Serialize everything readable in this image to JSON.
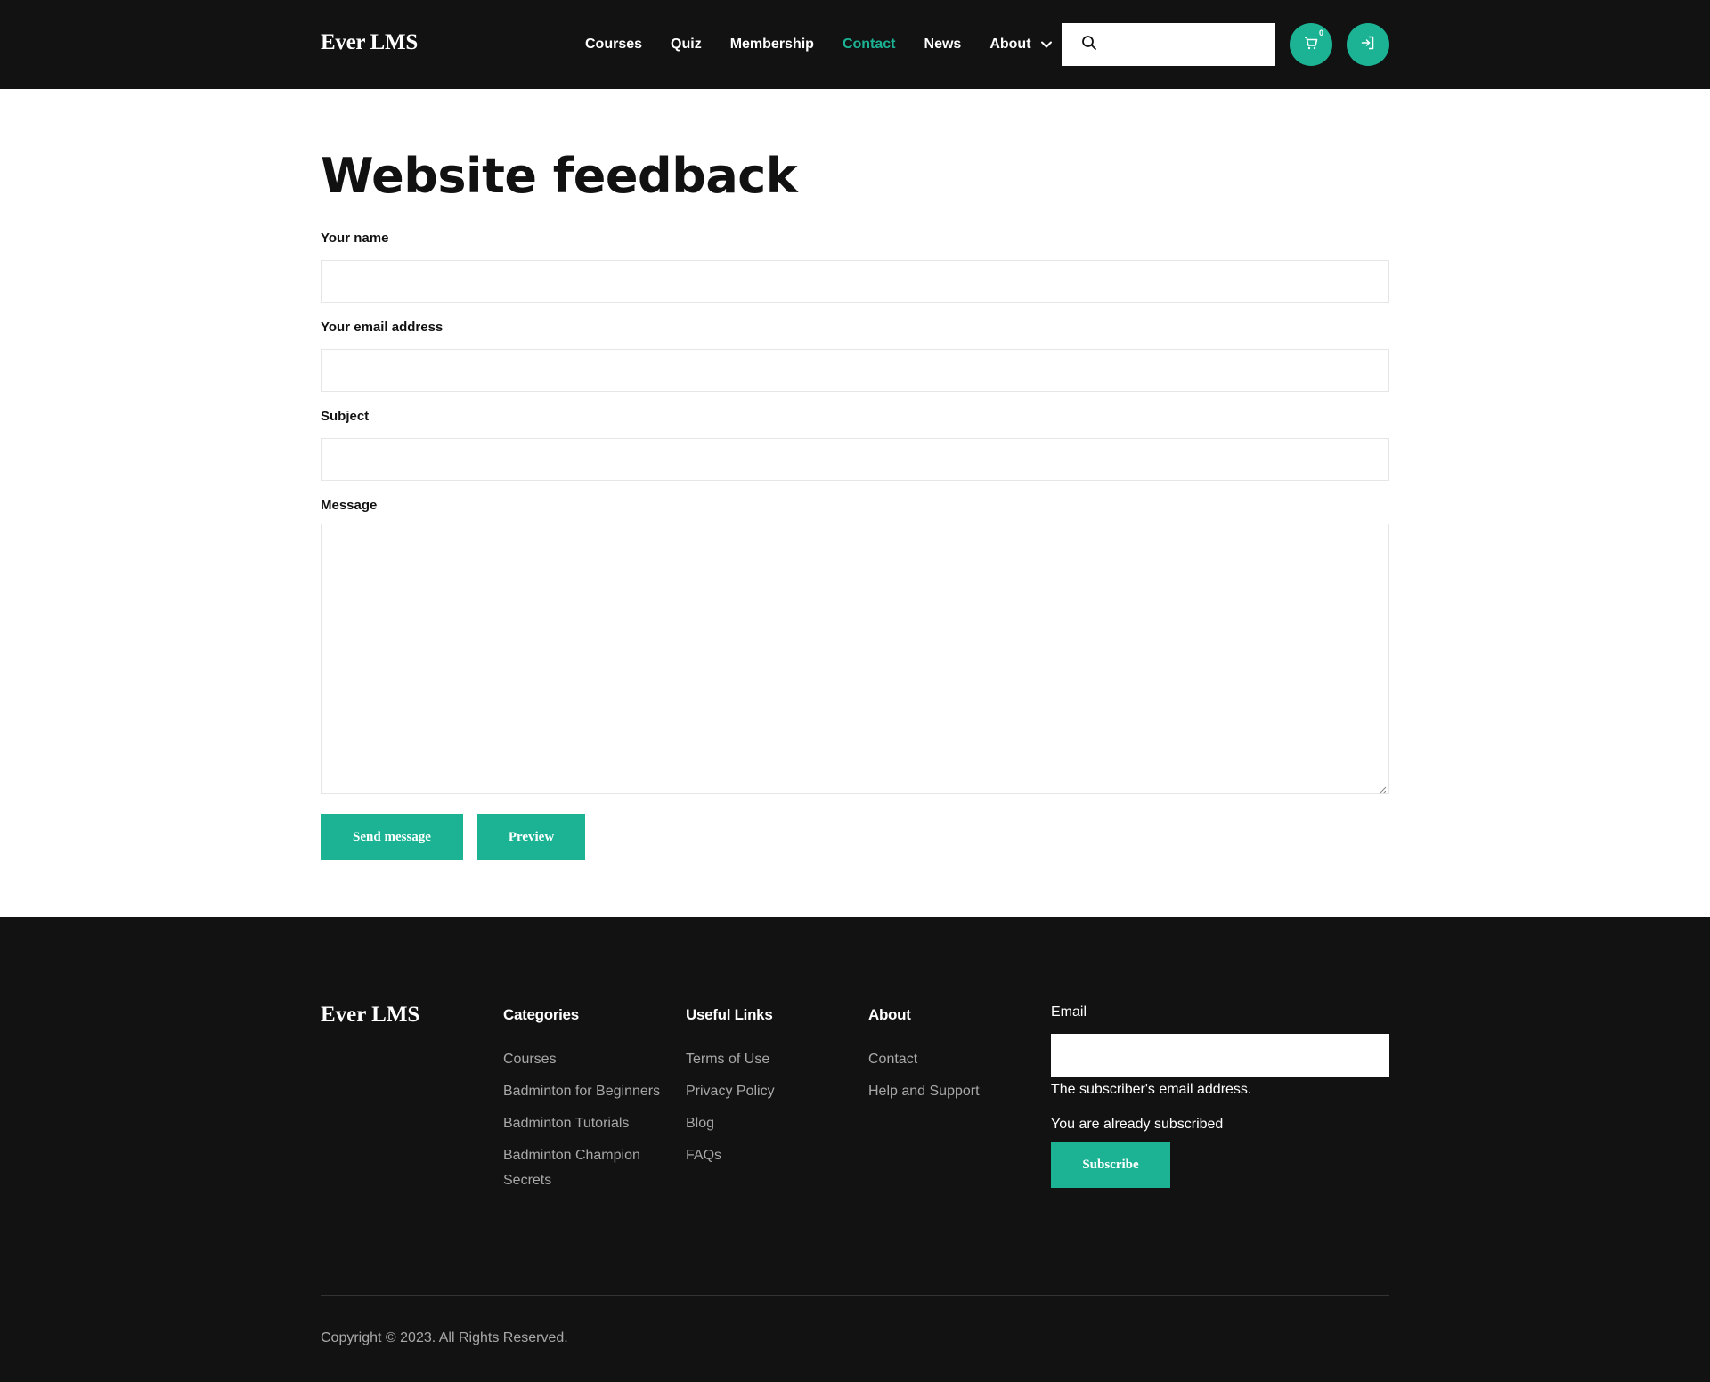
{
  "header": {
    "logo": "Ever LMS",
    "nav": [
      {
        "label": "Courses"
      },
      {
        "label": "Quiz"
      },
      {
        "label": "Membership"
      },
      {
        "label": "Contact"
      },
      {
        "label": "News"
      },
      {
        "label": "About"
      }
    ],
    "active_nav": "Contact",
    "cart_count": "0",
    "icons": {
      "search": "search-icon",
      "cart": "cart-icon",
      "login": "login-icon",
      "dropdown": "chevron-down-icon"
    }
  },
  "main": {
    "title": "Website feedback",
    "fields": {
      "name_label": "Your name",
      "email_label": "Your email address",
      "subject_label": "Subject",
      "message_label": "Message"
    },
    "buttons": {
      "send": "Send message",
      "preview": "Preview"
    }
  },
  "footer": {
    "logo": "Ever LMS",
    "categories": {
      "title": "Categories",
      "items": [
        "Courses",
        "Badminton for Beginners",
        "Badminton Tutorials",
        "Badminton Champion Secrets"
      ]
    },
    "useful_links": {
      "title": "Useful Links",
      "items": [
        "Terms of Use",
        "Privacy Policy",
        "Blog",
        "FAQs"
      ]
    },
    "about": {
      "title": "About",
      "items": [
        "Contact",
        "Help and Support"
      ]
    },
    "subscribe": {
      "email_label": "Email",
      "help_text": "The subscriber's email address.",
      "status": "You are already subscribed",
      "button": "Subscribe"
    },
    "copyright": "Copyright © 2023. All Rights Reserved."
  },
  "colors": {
    "accent": "#1bb394",
    "dark": "#121212"
  }
}
